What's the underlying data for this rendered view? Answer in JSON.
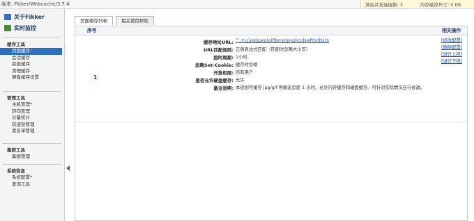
{
  "topbar": {
    "version": "版本: Fikker/Webcache/3.7.4",
    "stat_concurrent": "源站并发连接数: 3",
    "stat_memory": "内存缓存尺寸: 0 KB"
  },
  "sidebar": {
    "about": "关于Fikker",
    "monitor": "实时监控",
    "groups": [
      {
        "title": "缓存工具",
        "items": [
          {
            "label": "页面缓存",
            "star": "*"
          },
          {
            "label": "会话缓存",
            "star": ""
          },
          {
            "label": "拒绝缓存",
            "star": ""
          },
          {
            "label": "清理缓存",
            "star": ""
          },
          {
            "label": "硬盘缓存设置",
            "star": ""
          }
        ]
      },
      {
        "title": "管理工具",
        "items": [
          {
            "label": "主机管理",
            "star": "*"
          },
          {
            "label": "转向管理",
            "star": ""
          },
          {
            "label": "分量统计",
            "star": ""
          },
          {
            "label": "防盗链管理",
            "star": ""
          },
          {
            "label": "黑名单管理",
            "star": ""
          }
        ]
      },
      {
        "title": "集群工具",
        "items": [
          {
            "label": "集群管理",
            "star": ""
          }
        ]
      },
      {
        "title": "系统信息",
        "items": [
          {
            "label": "系统配置",
            "star": "*"
          },
          {
            "label": "查询工具",
            "star": ""
          }
        ]
      }
    ]
  },
  "tabs": [
    "页面缓存列表",
    "相关使用帮助"
  ],
  "table": {
    "col_index": "序号",
    "col_actions": "相关操作",
    "rows": [
      {
        "index": "1",
        "fields": [
          {
            "key": "缓存地址URL:",
            "value": "^.+\\.(jpg|jpeg|gif|bmp|png|ico|swf|txt|ts)$"
          },
          {
            "key": "URL匹配规则:",
            "value": "正则表达式匹配（匹配时忽略大小写）"
          },
          {
            "key": "超时周期:",
            "value": "1小时"
          },
          {
            "key": "忽略Set-Cookie:",
            "value": "缓存时忽略"
          },
          {
            "key": "开放权限:",
            "value": "所有用户"
          },
          {
            "key": "是否允许硬盘缓存:",
            "value": "允许"
          },
          {
            "key": "备注说明:",
            "value": "本规则可缓存 jpg/gif 等静态页面 1 小时。允许内存缓存和硬盘缓存。可针对实际情况自行修改。"
          }
        ],
        "actions": [
          "[修改配置]",
          "[删除配置]",
          "[进行上移]",
          "[进行下移]"
        ]
      }
    ]
  },
  "colors": {
    "accent": "#2f6fc0",
    "link": "#1a4fb0",
    "star": "#d62020",
    "index": "#b01010"
  }
}
